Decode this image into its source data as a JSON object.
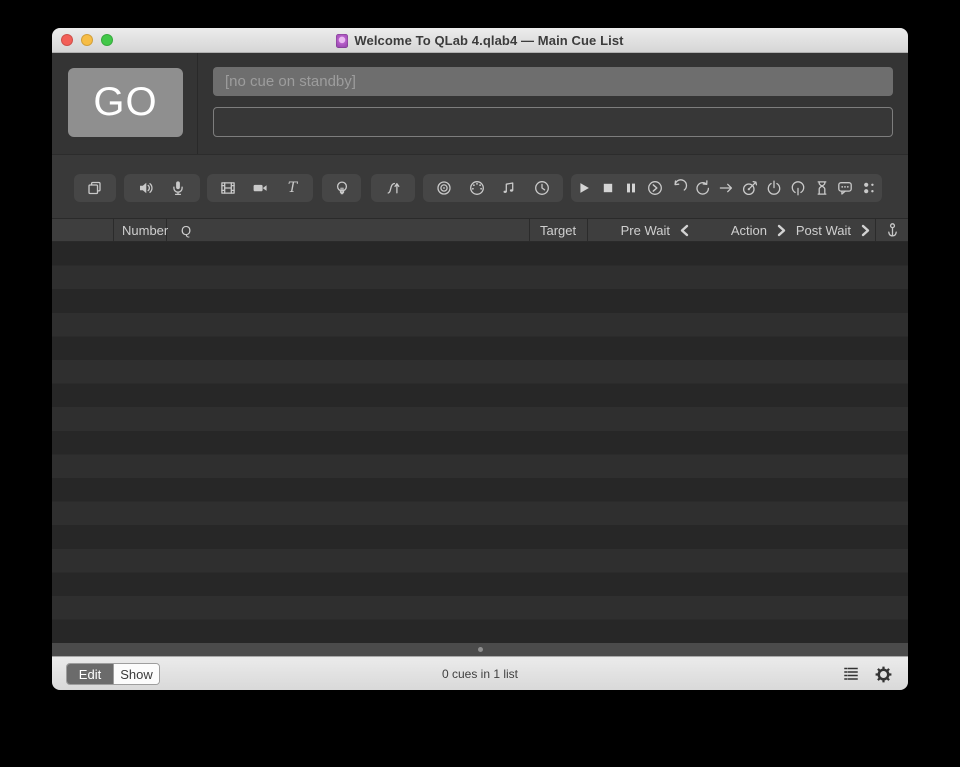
{
  "window": {
    "title": "Welcome To QLab 4.qlab4 — Main Cue List",
    "traffic_lights": [
      "close",
      "minimize",
      "zoom"
    ]
  },
  "transport": {
    "go_label": "GO",
    "standby_text": "[no cue on standby]",
    "notes_value": ""
  },
  "toolbar": {
    "cue_groups": [
      {
        "icons": [
          "group"
        ]
      },
      {
        "icons": [
          "audio",
          "mic"
        ]
      },
      {
        "icons": [
          "video",
          "camera",
          "text"
        ]
      },
      {
        "icons": [
          "light"
        ]
      },
      {
        "icons": [
          "fade"
        ]
      },
      {
        "icons": [
          "network",
          "midi",
          "midi-file",
          "timecode"
        ]
      },
      {
        "icons": [
          "start",
          "stop",
          "pause",
          "load",
          "reset",
          "devamp",
          "goto",
          "target",
          "arm",
          "disarm",
          "wait",
          "memo",
          "script"
        ]
      }
    ]
  },
  "cue_list_header": {
    "columns": [
      {
        "label": ""
      },
      {
        "label": "Number"
      },
      {
        "label": "Q"
      },
      {
        "label": "Target"
      },
      {
        "label": "Pre Wait",
        "chevron": "left"
      },
      {
        "label": "Action",
        "chevron": "right"
      },
      {
        "label": "Post Wait",
        "chevron": "right"
      },
      {
        "label": "",
        "icon": "auto-continue"
      }
    ]
  },
  "status_bar": {
    "edit_label": "Edit",
    "show_label": "Show",
    "status_text": "0 cues in 1 list",
    "icons": [
      "cue-lists",
      "settings"
    ]
  },
  "colors": {
    "go_button": "#8f8f8f",
    "row_dark": "#272727",
    "row_light": "#2f2f2f",
    "toolbar_button": "#464646",
    "traffic_red": "#f35f58",
    "traffic_yellow": "#f7bd45",
    "traffic_green": "#42c849"
  }
}
